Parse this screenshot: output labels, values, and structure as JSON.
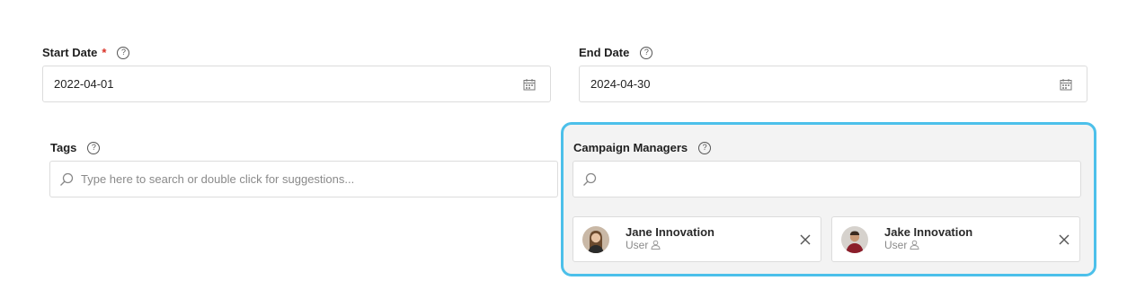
{
  "start_date": {
    "label": "Start Date",
    "required_mark": "*",
    "help_icon": "help-circle-icon",
    "value": "2022-04-01",
    "picker_icon": "calendar-icon"
  },
  "end_date": {
    "label": "End Date",
    "help_icon": "help-circle-icon",
    "value": "2024-04-30",
    "picker_icon": "calendar-icon"
  },
  "tags": {
    "label": "Tags",
    "help_icon": "help-circle-icon",
    "placeholder": "Type here to search or double click for suggestions..."
  },
  "campaign_managers": {
    "label": "Campaign Managers",
    "help_icon": "help-circle-icon",
    "search_value": "",
    "highlight_color": "#4cc0ea",
    "selected": [
      {
        "name": "Jane Innovation",
        "role": "User",
        "role_icon": "user-icon",
        "remove_icon": "close-icon"
      },
      {
        "name": "Jake Innovation",
        "role": "User",
        "role_icon": "user-icon",
        "remove_icon": "close-icon"
      }
    ]
  },
  "colors": {
    "required": "#d93025",
    "border": "#dcdcdc",
    "panel_bg": "#f3f3f3"
  }
}
